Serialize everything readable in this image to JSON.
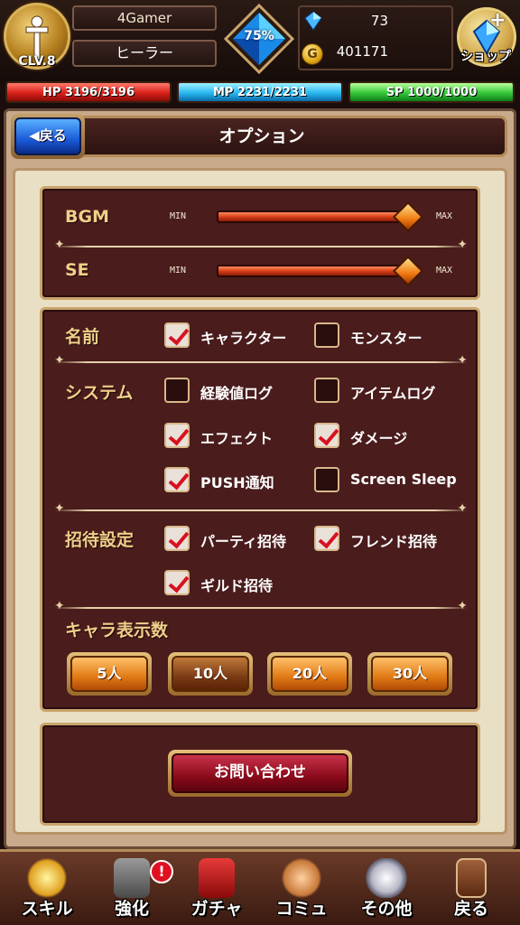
{
  "player": {
    "level": "CLV.8",
    "name": "4Gamer",
    "class": "ヒーラー",
    "exp_percent": "75%",
    "crystals": "73",
    "gold": "401171",
    "gold_icon_glyph": "G",
    "shop_label": "ショップ"
  },
  "bars": {
    "hp": "HP 3196/3196",
    "mp": "MP 2231/2231",
    "sp": "SP 1000/1000"
  },
  "header": {
    "back_label": "◀戻る",
    "title": "オプション"
  },
  "sound": {
    "bgm_label": "BGM",
    "se_label": "SE",
    "min": "MIN",
    "max": "MAX",
    "bgm_level": 1.0,
    "se_level": 1.0
  },
  "options": {
    "name_label": "名前",
    "system_label": "システム",
    "invite_label": "招待設定",
    "count_label": "キャラ表示数",
    "items": [
      {
        "label": "キャラクター",
        "checked": true
      },
      {
        "label": "モンスター",
        "checked": false
      },
      {
        "label": "経験値ログ",
        "checked": false
      },
      {
        "label": "アイテムログ",
        "checked": false
      },
      {
        "label": "エフェクト",
        "checked": true
      },
      {
        "label": "ダメージ",
        "checked": true
      },
      {
        "label": "PUSH通知",
        "checked": true
      },
      {
        "label": "Screen Sleep",
        "checked": false
      },
      {
        "label": "パーティ招待",
        "checked": true
      },
      {
        "label": "フレンド招待",
        "checked": true
      },
      {
        "label": "ギルド招待",
        "checked": true
      }
    ],
    "counts": [
      "5人",
      "10人",
      "20人",
      "30人"
    ],
    "selected_count": "10人"
  },
  "contact_label": "お問い合わせ",
  "nav": {
    "items": [
      "スキル",
      "強化",
      "ガチャ",
      "コミュ",
      "その他",
      "戻る"
    ],
    "alert": "!"
  },
  "colors": {
    "accent": "#c9a46c",
    "panel": "#4a1c1c",
    "label": "#f0cf8a"
  }
}
